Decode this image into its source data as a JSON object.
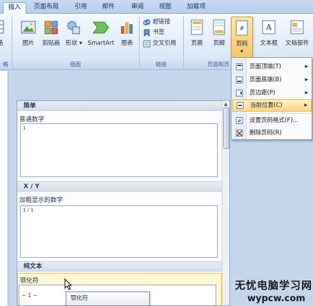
{
  "tabs": [
    "插入",
    "页面布局",
    "引用",
    "邮件",
    "审阅",
    "视图",
    "加载项"
  ],
  "active_tab": "插入",
  "ribbon": {
    "left_partial_label": "格",
    "left_partial_group": "格",
    "illustrations": {
      "buttons": [
        "图片",
        "剪贴画",
        "形状",
        "SmartArt",
        "图表"
      ],
      "group_label": "插图"
    },
    "links": {
      "buttons": [
        "超链接",
        "书签",
        "交叉引用"
      ],
      "group_label": "链接"
    },
    "header_footer": {
      "buttons": [
        "页眉",
        "页脚",
        "页码"
      ],
      "group_label": "页眉和页"
    },
    "text": {
      "buttons": [
        "文本框",
        "文档部件"
      ]
    }
  },
  "menu": {
    "items": [
      {
        "label": "页面顶端(T)",
        "submenu": true,
        "icon": "page-top-icon"
      },
      {
        "label": "页面底端(B)",
        "submenu": true,
        "icon": "page-bottom-icon"
      },
      {
        "label": "页边距(P)",
        "submenu": true,
        "icon": "page-margin-icon"
      },
      {
        "label": "当前位置(C)",
        "submenu": true,
        "icon": "current-position-icon",
        "highlighted": true
      },
      {
        "label": "设置页码格式(F)...",
        "submenu": false,
        "icon": "format-page-number-icon"
      },
      {
        "label": "删除页码(R)",
        "submenu": false,
        "icon": "delete-page-number-icon"
      }
    ]
  },
  "gallery": {
    "sections": [
      {
        "header": "简单",
        "item_title": "普通数字",
        "preview": "1"
      },
      {
        "header": "X / Y",
        "item_title": "加粗显示的数字",
        "preview": "1 / 1"
      },
      {
        "header": "纯文本",
        "item_title": "颚化符",
        "preview": "~ 1 ~"
      }
    ],
    "tooltip": "颚化符"
  },
  "watermark": {
    "line1": "无忧电脑学习网",
    "line2": "wypcw.com"
  },
  "colors": {
    "ribbon_bg": "#e3edf9",
    "highlight": "#fcd882",
    "hover_item": "#fff7d6"
  }
}
